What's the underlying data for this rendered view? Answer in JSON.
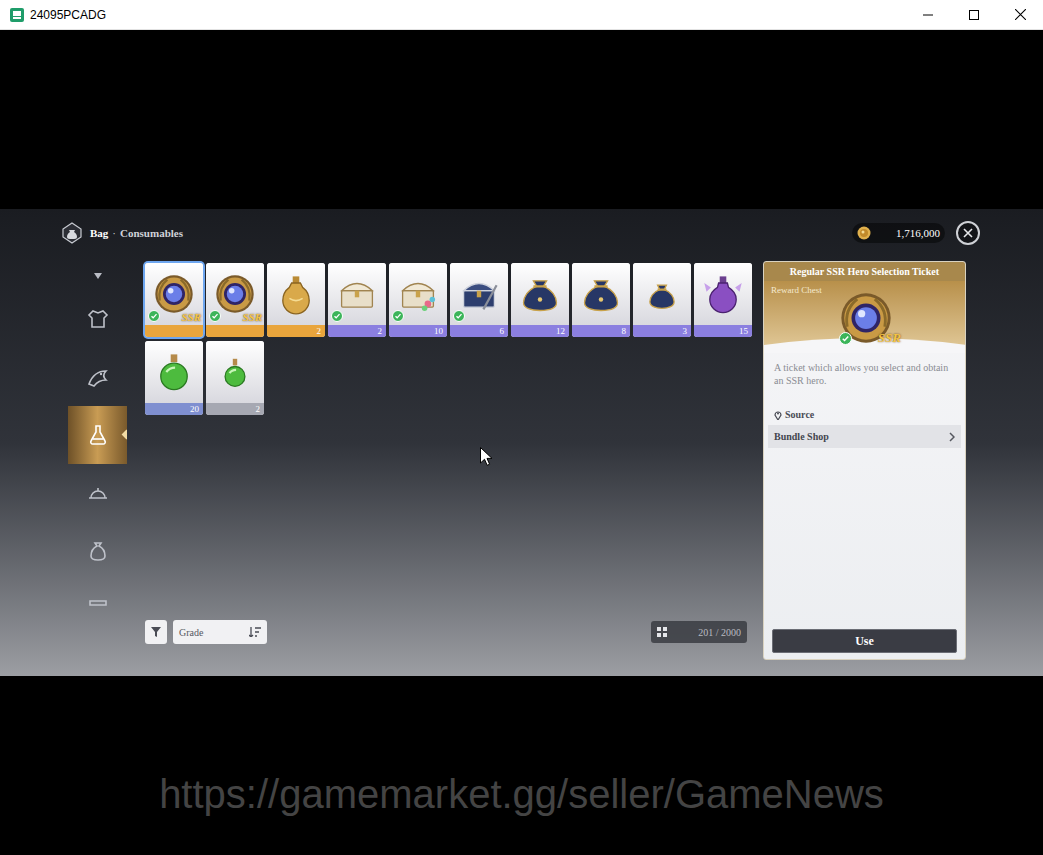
{
  "window": {
    "title": "24095PCADG"
  },
  "header": {
    "title": "Bag",
    "separator": "·",
    "section": "Consumables"
  },
  "currency": {
    "amount": "1,716,000"
  },
  "sidebar": {
    "items": [
      {
        "selected": false
      },
      {
        "selected": false
      },
      {
        "selected": true
      },
      {
        "selected": false
      },
      {
        "selected": false
      },
      {
        "selected": false
      }
    ]
  },
  "items": [
    {
      "kind": "ticket",
      "badge": "SSR",
      "count": "",
      "checked": true,
      "selected": true,
      "color": "#e9a53c"
    },
    {
      "kind": "ticket",
      "badge": "SSR",
      "count": "",
      "checked": true,
      "selected": false,
      "color": "#e9a53c"
    },
    {
      "kind": "elixir",
      "badge": "",
      "count": "2",
      "checked": false,
      "selected": false,
      "color": "#e9a53c"
    },
    {
      "kind": "chest",
      "badge": "",
      "count": "2",
      "checked": true,
      "selected": false,
      "color": "#8b7fe0"
    },
    {
      "kind": "gemchest",
      "badge": "",
      "count": "10",
      "checked": true,
      "selected": false,
      "color": "#8b7fe0"
    },
    {
      "kind": "darkchest",
      "badge": "",
      "count": "6",
      "checked": true,
      "selected": false,
      "color": "#8b7fe0"
    },
    {
      "kind": "bag",
      "badge": "",
      "count": "12",
      "checked": false,
      "selected": false,
      "color": "#8b7fe0"
    },
    {
      "kind": "bag",
      "badge": "",
      "count": "8",
      "checked": false,
      "selected": false,
      "color": "#8b7fe0"
    },
    {
      "kind": "pouch",
      "badge": "",
      "count": "3",
      "checked": false,
      "selected": false,
      "color": "#8b7fe0"
    },
    {
      "kind": "potion",
      "badge": "",
      "count": "15",
      "checked": false,
      "selected": false,
      "color": "#8b7fe0"
    },
    {
      "kind": "flask",
      "badge": "",
      "count": "20",
      "checked": false,
      "selected": false,
      "color": "#7f8fd0"
    },
    {
      "kind": "vial",
      "badge": "",
      "count": "2",
      "checked": false,
      "selected": false,
      "color": "#a6a8b2"
    }
  ],
  "toolbar": {
    "sort": "Grade",
    "capacity": "201 / 2000"
  },
  "detail": {
    "title": "Regular SSR Hero Selection Ticket",
    "category": "Reward Chest",
    "badge": "SSR",
    "checked": true,
    "description": "A ticket which allows you select and obtain an SSR hero.",
    "source_label": "Source",
    "sources": [
      "Bundle Shop"
    ],
    "action": "Use"
  },
  "watermark": "https://gamemarket.gg/seller/GameNews"
}
